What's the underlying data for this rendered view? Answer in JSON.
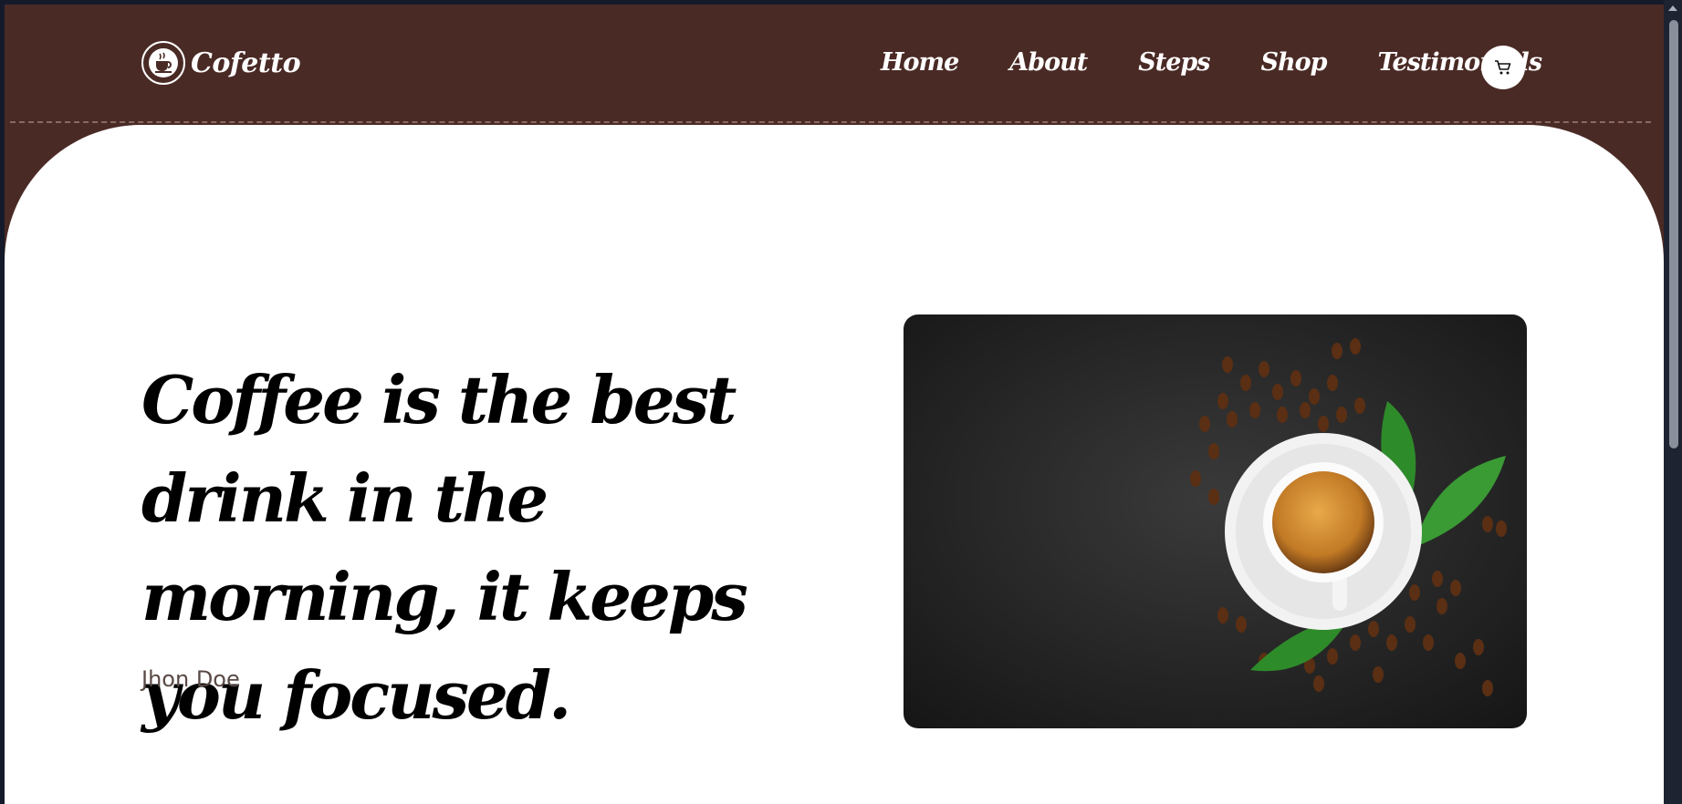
{
  "brand": {
    "name": "Cofetto",
    "logo_icon": "coffee-cup-icon"
  },
  "nav": {
    "items": [
      "Home",
      "About",
      "Steps",
      "Shop",
      "Testimonials"
    ],
    "cart_icon": "cart-icon"
  },
  "hero": {
    "quote": "Coffee is the best drink in the morning, it keeps you focused.",
    "author": "Jhon Doe"
  },
  "colors": {
    "header_bg": "#4a2a25",
    "hero_bg": "#ffffff",
    "text_dark": "#000000",
    "author": "#5a4a46"
  }
}
